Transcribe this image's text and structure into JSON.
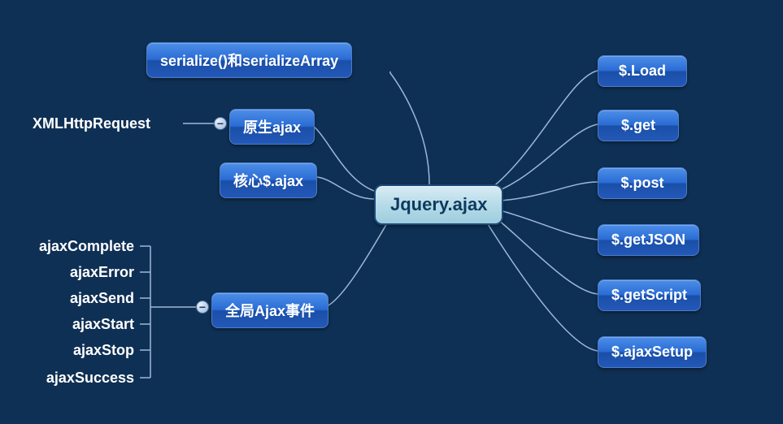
{
  "central": {
    "label": "Jquery.ajax"
  },
  "left_nodes": {
    "serialize": {
      "label": "serialize()和serializeArray"
    },
    "native_ajax": {
      "label": "原生ajax"
    },
    "core_ajax": {
      "label": "核心$.ajax"
    },
    "global_events": {
      "label": "全局Ajax事件"
    }
  },
  "right_nodes": {
    "load": {
      "label": "$.Load"
    },
    "get": {
      "label": "$.get"
    },
    "post": {
      "label": "$.post"
    },
    "getjson": {
      "label": "$.getJSON"
    },
    "getscript": {
      "label": "$.getScript"
    },
    "ajaxsetup": {
      "label": "$.ajaxSetup"
    }
  },
  "native_ajax_child": {
    "label": "XMLHttpRequest"
  },
  "global_events_children": [
    {
      "label": "ajaxComplete"
    },
    {
      "label": "ajaxError"
    },
    {
      "label": "ajaxSend"
    },
    {
      "label": "ajaxStart"
    },
    {
      "label": "ajaxStop"
    },
    {
      "label": "ajaxSuccess"
    }
  ],
  "collapse_glyph": "−"
}
